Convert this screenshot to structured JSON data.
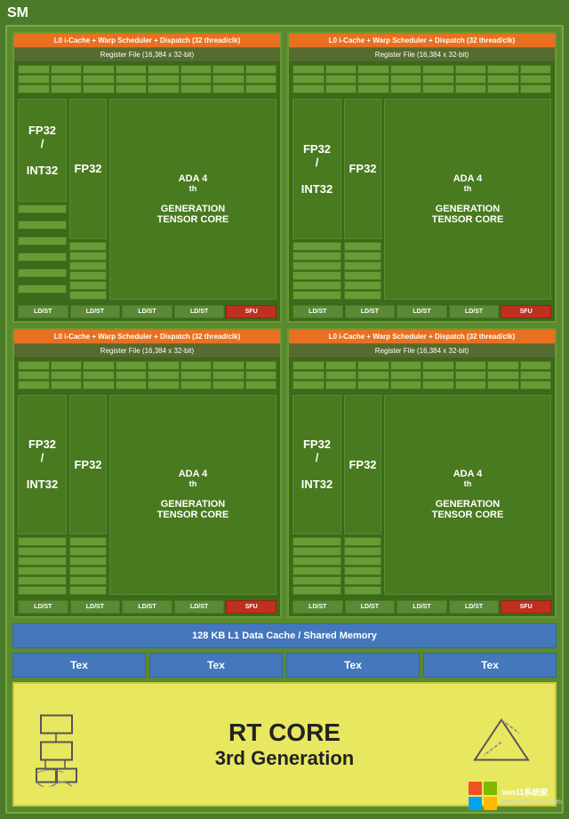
{
  "sm_label": "SM",
  "quadrants": [
    {
      "l0": "L0 i-Cache + Warp Scheduler + Dispatch (32 thread/clk)",
      "register_file": "Register File (16,384 x 32-bit)",
      "fp32_int32": "FP32\n/\nINT32",
      "fp32": "FP32",
      "ada": "ADA 4th\nGENERATION\nTENSOR CORE",
      "units": [
        "LD/ST",
        "LD/ST",
        "LD/ST",
        "LD/ST",
        "SFU"
      ]
    },
    {
      "l0": "L0 i-Cache + Warp Scheduler + Dispatch (32 thread/clk)",
      "register_file": "Register File (16,384 x 32-bit)",
      "fp32_int32": "FP32\n/\nINT32",
      "fp32": "FP32",
      "ada": "ADA 4th\nGENERATION\nTENSOR CORE",
      "units": [
        "LD/ST",
        "LD/ST",
        "LD/ST",
        "LD/ST",
        "SFU"
      ]
    },
    {
      "l0": "L0 i-Cache + Warp Scheduler + Dispatch (32 thread/clk)",
      "register_file": "Register File (16,384 x 32-bit)",
      "fp32_int32": "FP32\n/\nINT32",
      "fp32": "FP32",
      "ada": "ADA 4th\nGENERATION\nTENSOR CORE",
      "units": [
        "LD/ST",
        "LD/ST",
        "LD/ST",
        "LD/ST",
        "SFU"
      ]
    },
    {
      "l0": "L0 i-Cache + Warp Scheduler + Dispatch (32 thread/clk)",
      "register_file": "Register File (16,384 x 32-bit)",
      "fp32_int32": "FP32\n/\nINT32",
      "fp32": "FP32",
      "ada": "ADA 4th\nGENERATION\nTENSOR CORE",
      "units": [
        "LD/ST",
        "LD/ST",
        "LD/ST",
        "LD/ST",
        "SFU"
      ]
    }
  ],
  "l1_cache": "128 KB L1 Data Cache / Shared Memory",
  "tex_boxes": [
    "Tex",
    "Tex",
    "Tex",
    "Tex"
  ],
  "rt_core_title": "RT CORE",
  "rt_core_sub": "3rd Generation",
  "watermark_site": "win11系统家",
  "watermark_url": "www.relsound.com"
}
